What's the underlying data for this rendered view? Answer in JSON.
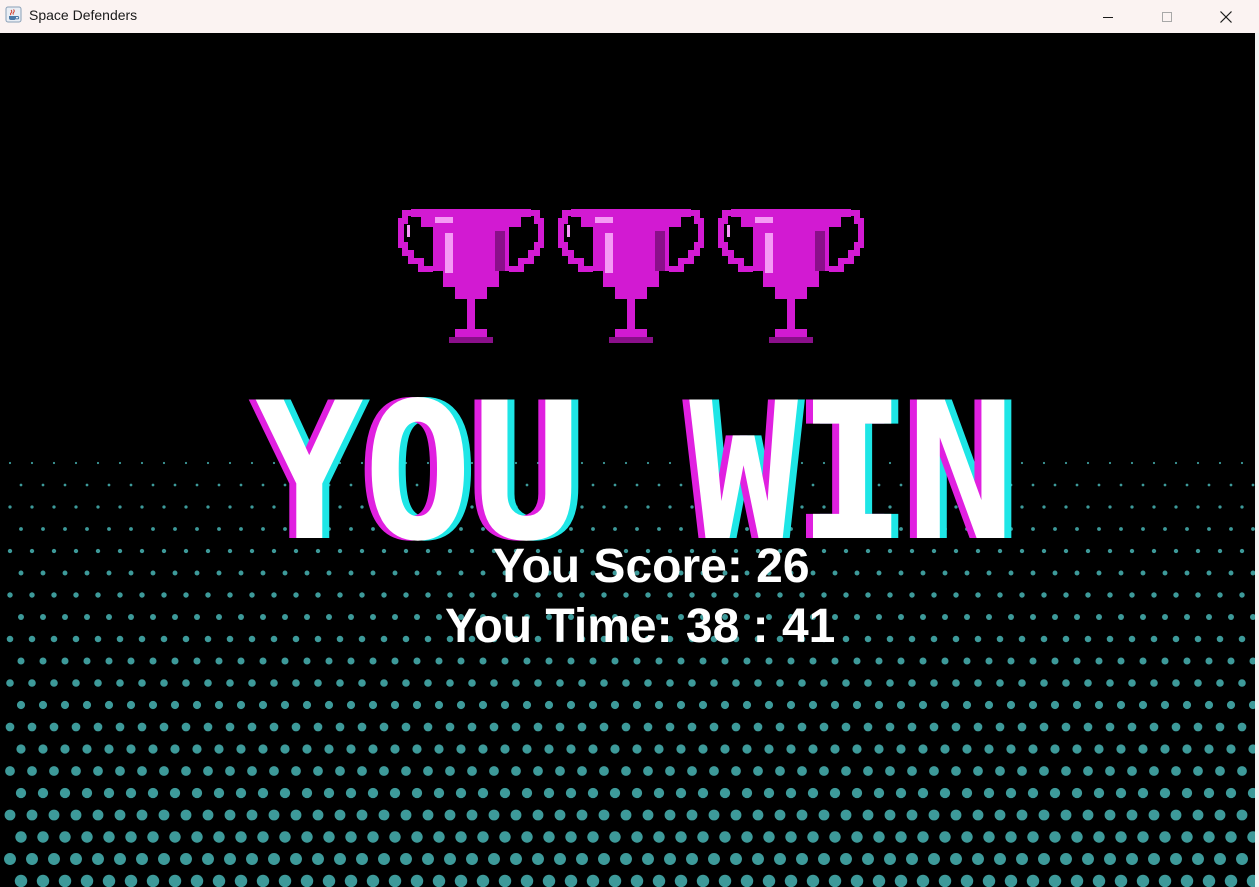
{
  "window": {
    "title": "Space Defenders",
    "app_icon": "java-cup-icon",
    "controls": [
      "minimize-icon",
      "maximize-icon",
      "close-icon"
    ]
  },
  "game": {
    "trophy_count": 3,
    "trophy_icon": "trophy-icon",
    "banner_text": "YOU WIN",
    "score_line": "You Score: 26",
    "time_line": "You Time: 38 : 41",
    "colors": {
      "background": "#000000",
      "trophy": "#d21ad2",
      "trophy_highlight": "#f59af5",
      "trophy_shadow": "#8a0f8a",
      "banner_fill": "#ffffff",
      "banner_magenta": "#e020e0",
      "banner_cyan": "#1ee6e6",
      "dots": "#3d9a9a",
      "text": "#ffffff"
    }
  }
}
